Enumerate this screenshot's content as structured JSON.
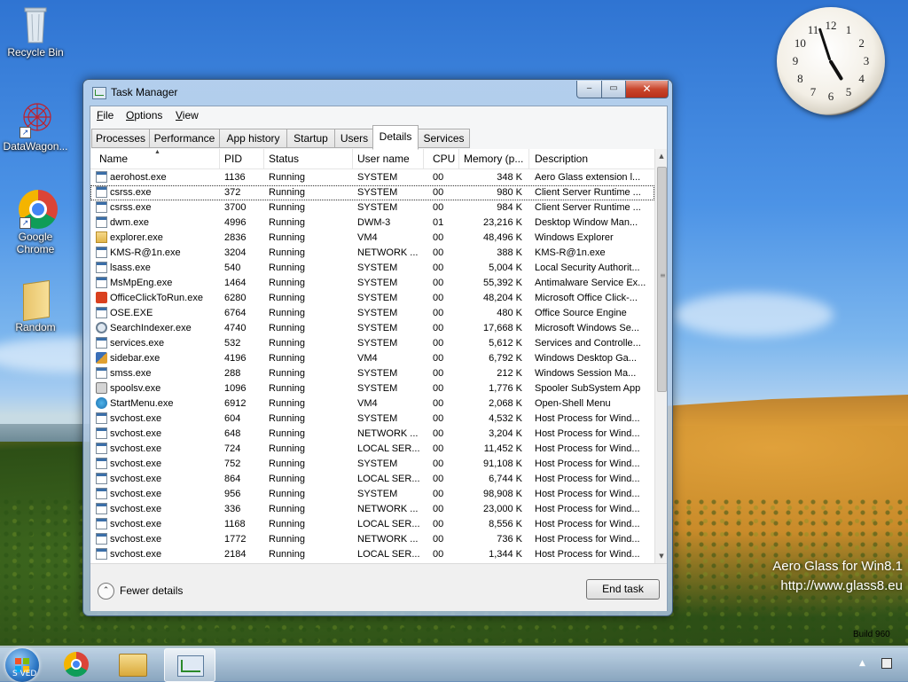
{
  "desktop": {
    "icons": [
      {
        "label": "Recycle Bin"
      },
      {
        "label": "DataWagon..."
      },
      {
        "label": "Google Chrome"
      },
      {
        "label": "Random"
      }
    ],
    "watermark_line1": "Aero Glass for Win8.1",
    "watermark_line2": "http://www.glass8.eu",
    "build_tag": "Build 960",
    "start_tag": "S VED"
  },
  "clock": {
    "numerals": [
      "12",
      "1",
      "2",
      "3",
      "4",
      "5",
      "6",
      "7",
      "8",
      "9",
      "10",
      "11"
    ],
    "time": "4:57"
  },
  "window": {
    "title": "Task Manager",
    "controls": {
      "minimize": "‒",
      "maximize": "▭",
      "close": "✕"
    },
    "menu": [
      {
        "label": "File",
        "u": "F",
        "rest": "ile"
      },
      {
        "label": "Options",
        "u": "O",
        "rest": "ptions"
      },
      {
        "label": "View",
        "u": "V",
        "rest": "iew"
      }
    ],
    "tabs": [
      "Processes",
      "Performance",
      "App history",
      "Startup",
      "Users",
      "Details",
      "Services"
    ],
    "active_tab": "Details",
    "columns": [
      "Name",
      "PID",
      "Status",
      "User name",
      "CPU",
      "Memory (p...",
      "Description"
    ],
    "sort_indicator": "▲",
    "processes": [
      {
        "icon": "exe",
        "name": "aerohost.exe",
        "pid": "1136",
        "status": "Running",
        "user": "SYSTEM",
        "cpu": "00",
        "mem": "348 K",
        "desc": "Aero Glass extension l..."
      },
      {
        "icon": "exe",
        "name": "csrss.exe",
        "pid": "372",
        "status": "Running",
        "user": "SYSTEM",
        "cpu": "00",
        "mem": "980 K",
        "desc": "Client Server Runtime ...",
        "selected": true
      },
      {
        "icon": "exe",
        "name": "csrss.exe",
        "pid": "3700",
        "status": "Running",
        "user": "SYSTEM",
        "cpu": "00",
        "mem": "984 K",
        "desc": "Client Server Runtime ..."
      },
      {
        "icon": "exe",
        "name": "dwm.exe",
        "pid": "4996",
        "status": "Running",
        "user": "DWM-3",
        "cpu": "01",
        "mem": "23,216 K",
        "desc": "Desktop Window Man..."
      },
      {
        "icon": "folder",
        "name": "explorer.exe",
        "pid": "2836",
        "status": "Running",
        "user": "VM4",
        "cpu": "00",
        "mem": "48,496 K",
        "desc": "Windows Explorer"
      },
      {
        "icon": "exe",
        "name": "KMS-R@1n.exe",
        "pid": "3204",
        "status": "Running",
        "user": "NETWORK ...",
        "cpu": "00",
        "mem": "388 K",
        "desc": "KMS-R@1n.exe"
      },
      {
        "icon": "exe",
        "name": "lsass.exe",
        "pid": "540",
        "status": "Running",
        "user": "SYSTEM",
        "cpu": "00",
        "mem": "5,004 K",
        "desc": "Local Security Authorit..."
      },
      {
        "icon": "exe",
        "name": "MsMpEng.exe",
        "pid": "1464",
        "status": "Running",
        "user": "SYSTEM",
        "cpu": "00",
        "mem": "55,392 K",
        "desc": "Antimalware Service Ex..."
      },
      {
        "icon": "office",
        "name": "OfficeClickToRun.exe",
        "pid": "6280",
        "status": "Running",
        "user": "SYSTEM",
        "cpu": "00",
        "mem": "48,204 K",
        "desc": "Microsoft Office Click-..."
      },
      {
        "icon": "exe",
        "name": "OSE.EXE",
        "pid": "6764",
        "status": "Running",
        "user": "SYSTEM",
        "cpu": "00",
        "mem": "480 K",
        "desc": "Office Source Engine"
      },
      {
        "icon": "search",
        "name": "SearchIndexer.exe",
        "pid": "4740",
        "status": "Running",
        "user": "SYSTEM",
        "cpu": "00",
        "mem": "17,668 K",
        "desc": "Microsoft Windows Se..."
      },
      {
        "icon": "exe",
        "name": "services.exe",
        "pid": "532",
        "status": "Running",
        "user": "SYSTEM",
        "cpu": "00",
        "mem": "5,612 K",
        "desc": "Services and Controlle..."
      },
      {
        "icon": "gadget",
        "name": "sidebar.exe",
        "pid": "4196",
        "status": "Running",
        "user": "VM4",
        "cpu": "00",
        "mem": "6,792 K",
        "desc": "Windows Desktop Ga..."
      },
      {
        "icon": "exe",
        "name": "smss.exe",
        "pid": "288",
        "status": "Running",
        "user": "SYSTEM",
        "cpu": "00",
        "mem": "212 K",
        "desc": "Windows Session Ma..."
      },
      {
        "icon": "printer",
        "name": "spoolsv.exe",
        "pid": "1096",
        "status": "Running",
        "user": "SYSTEM",
        "cpu": "00",
        "mem": "1,776 K",
        "desc": "Spooler SubSystem App"
      },
      {
        "icon": "start",
        "name": "StartMenu.exe",
        "pid": "6912",
        "status": "Running",
        "user": "VM4",
        "cpu": "00",
        "mem": "2,068 K",
        "desc": "Open-Shell Menu"
      },
      {
        "icon": "exe",
        "name": "svchost.exe",
        "pid": "604",
        "status": "Running",
        "user": "SYSTEM",
        "cpu": "00",
        "mem": "4,532 K",
        "desc": "Host Process for Wind..."
      },
      {
        "icon": "exe",
        "name": "svchost.exe",
        "pid": "648",
        "status": "Running",
        "user": "NETWORK ...",
        "cpu": "00",
        "mem": "3,204 K",
        "desc": "Host Process for Wind..."
      },
      {
        "icon": "exe",
        "name": "svchost.exe",
        "pid": "724",
        "status": "Running",
        "user": "LOCAL SER...",
        "cpu": "00",
        "mem": "11,452 K",
        "desc": "Host Process for Wind..."
      },
      {
        "icon": "exe",
        "name": "svchost.exe",
        "pid": "752",
        "status": "Running",
        "user": "SYSTEM",
        "cpu": "00",
        "mem": "91,108 K",
        "desc": "Host Process for Wind..."
      },
      {
        "icon": "exe",
        "name": "svchost.exe",
        "pid": "864",
        "status": "Running",
        "user": "LOCAL SER...",
        "cpu": "00",
        "mem": "6,744 K",
        "desc": "Host Process for Wind..."
      },
      {
        "icon": "exe",
        "name": "svchost.exe",
        "pid": "956",
        "status": "Running",
        "user": "SYSTEM",
        "cpu": "00",
        "mem": "98,908 K",
        "desc": "Host Process for Wind..."
      },
      {
        "icon": "exe",
        "name": "svchost.exe",
        "pid": "336",
        "status": "Running",
        "user": "NETWORK ...",
        "cpu": "00",
        "mem": "23,000 K",
        "desc": "Host Process for Wind..."
      },
      {
        "icon": "exe",
        "name": "svchost.exe",
        "pid": "1168",
        "status": "Running",
        "user": "LOCAL SER...",
        "cpu": "00",
        "mem": "8,556 K",
        "desc": "Host Process for Wind..."
      },
      {
        "icon": "exe",
        "name": "svchost.exe",
        "pid": "1772",
        "status": "Running",
        "user": "NETWORK ...",
        "cpu": "00",
        "mem": "736 K",
        "desc": "Host Process for Wind..."
      },
      {
        "icon": "exe",
        "name": "svchost.exe",
        "pid": "2184",
        "status": "Running",
        "user": "LOCAL SER...",
        "cpu": "00",
        "mem": "1,344 K",
        "desc": "Host Process for Wind..."
      }
    ],
    "footer": {
      "fewer_details": "Fewer details",
      "end_task": "End task",
      "chevron": "⌃"
    }
  },
  "taskbar": {
    "items": [
      {
        "name": "chrome",
        "icon": "chrome-icon"
      },
      {
        "name": "file-explorer",
        "icon": "folder-icon"
      },
      {
        "name": "task-manager",
        "icon": "task-manager-icon",
        "active": true
      }
    ],
    "tray_arrow": "▲"
  },
  "colors": {
    "close": "#c9462c",
    "selection_outline": "#333333"
  }
}
